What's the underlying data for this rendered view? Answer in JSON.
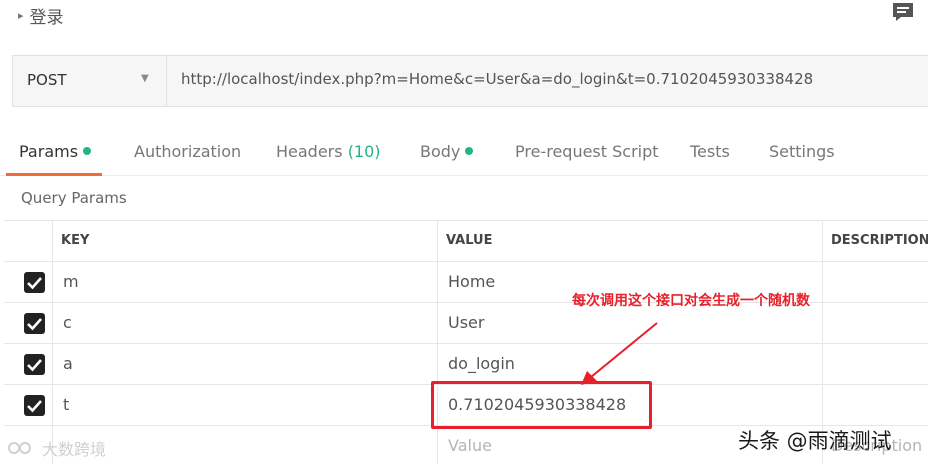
{
  "request": {
    "name": "登录",
    "collapse_glyph": "▸",
    "comment_icon": "comment-icon"
  },
  "url_bar": {
    "method": "POST",
    "method_caret": "▼",
    "url": "http://localhost/index.php?m=Home&c=User&a=do_login&t=0.7102045930338428"
  },
  "tabs": [
    {
      "label": "Params",
      "dot": true,
      "active": true
    },
    {
      "label": "Authorization"
    },
    {
      "label": "Headers",
      "count": "(10)"
    },
    {
      "label": "Body",
      "dot": true
    },
    {
      "label": "Pre-request Script"
    },
    {
      "label": "Tests"
    },
    {
      "label": "Settings"
    }
  ],
  "colors": {
    "accent": "#f26b3a",
    "dot_green": "#26b47f",
    "annotation_red": "#e8202a"
  },
  "query_params": {
    "title": "Query Params",
    "headers": {
      "key": "KEY",
      "value": "VALUE",
      "description": "DESCRIPTION"
    },
    "rows": [
      {
        "checked": true,
        "key": "m",
        "value": "Home"
      },
      {
        "checked": true,
        "key": "c",
        "value": "User"
      },
      {
        "checked": true,
        "key": "a",
        "value": "do_login"
      },
      {
        "checked": true,
        "key": "t",
        "value": "0.7102045930338428"
      }
    ],
    "placeholder": {
      "value": "Value",
      "description": "Description"
    }
  },
  "annotation": {
    "text": "每次调用这个接口对会生成一个随机数"
  },
  "watermark": {
    "left": "大数跨境",
    "right": "头条 @雨滴测试"
  }
}
